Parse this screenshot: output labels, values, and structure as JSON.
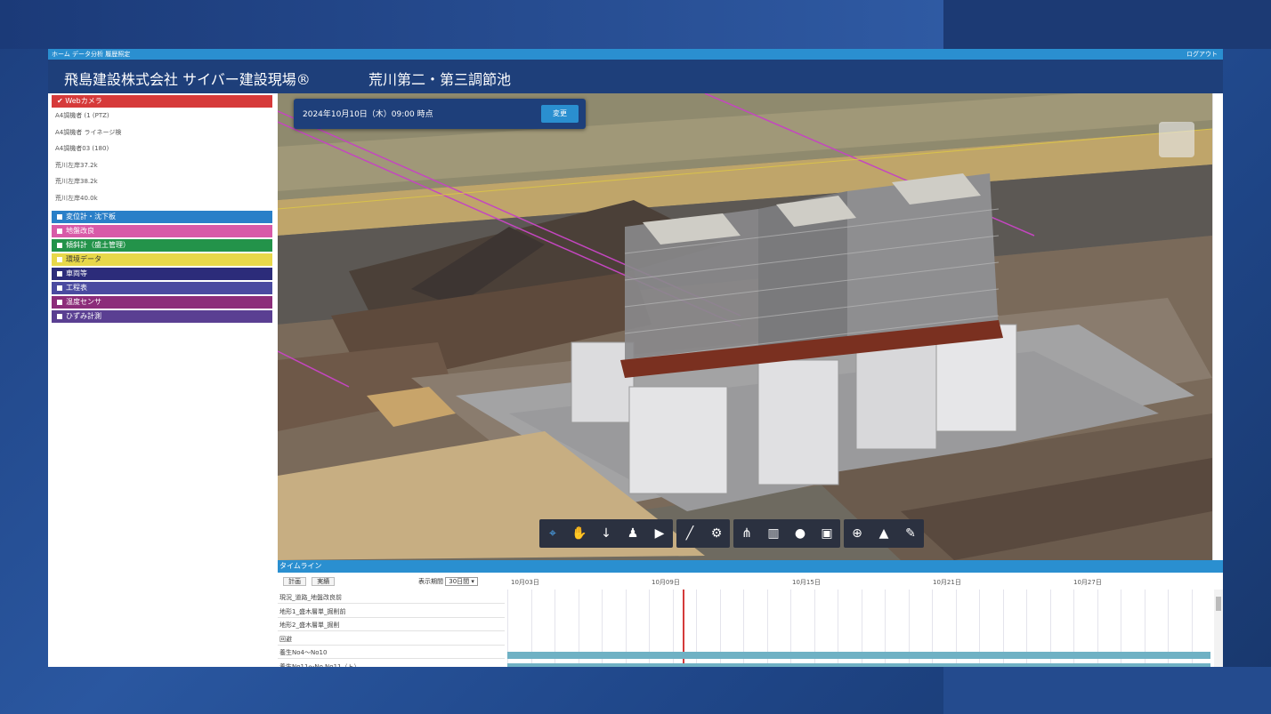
{
  "app": {
    "nav_links": "ホーム データ分析 履歴照定",
    "logout": "ログアウト",
    "title": "飛島建設株式会社 サイバー建設現場®",
    "site": "荒川第二・第三調節池"
  },
  "sidebar": {
    "webcam_header": "Webカメラ",
    "webcam_items": [
      "A4調機者 (1 (PTZ)",
      "A4調機者 ライネージ検",
      "A4調機者03 (180)",
      "荒川左岸37.2k",
      "荒川左岸38.2k",
      "荒川左岸40.0k"
    ],
    "layers": [
      {
        "label": "変位計・沈下板",
        "color": "#2a7fc8"
      },
      {
        "label": "地盤改良",
        "color": "#d85aa8"
      },
      {
        "label": "傾斜計（盛土管理）",
        "color": "#23934a"
      },
      {
        "label": "環境データ",
        "color": "#e8d84a"
      },
      {
        "label": "車両等",
        "color": "#2c2c7a"
      },
      {
        "label": "工程表",
        "color": "#4a4aa0"
      },
      {
        "label": "温度センサ",
        "color": "#8c2d7a"
      },
      {
        "label": "ひずみ計測",
        "color": "#5a3f92"
      }
    ]
  },
  "viewport": {
    "date_text": "2024年10月10日（木）09:00 時点",
    "change_button": "変更",
    "toolbar_icons": [
      [
        "cursor-icon",
        "hand-icon",
        "down-arrow-icon",
        "person-icon",
        "camera-icon"
      ],
      [
        "pen-icon",
        "settings-icon"
      ],
      [
        "hierarchy-icon",
        "trash-icon",
        "circle-icon",
        "square-icon"
      ],
      [
        "plus-circle-icon",
        "photo-icon",
        "pencil-icon"
      ]
    ]
  },
  "timeline": {
    "header": "タイムライン",
    "tab_plan": "計画",
    "tab_actual": "実績",
    "period_label": "表示期間",
    "period_value": "30日間",
    "dates": [
      "10月03日",
      "10月09日",
      "10月15日",
      "10月21日",
      "10月27日"
    ],
    "tasks": [
      "現況_道路_地盤改良前",
      "地形1_盛木層単_掘削前",
      "地形2_盛木層単_掘削",
      "回避",
      "養生No4～No10",
      "養生No11～No.No11（ト）"
    ]
  }
}
